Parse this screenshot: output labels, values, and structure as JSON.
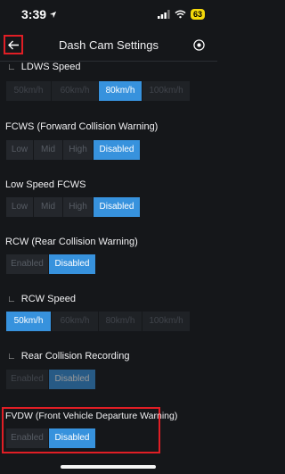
{
  "status": {
    "time": "3:39",
    "battery": "63"
  },
  "header": {
    "title": "Dash Cam Settings"
  },
  "ldws_speed": {
    "label": "LDWS Speed",
    "options": [
      "50km/h",
      "60km/h",
      "80km/h",
      "100km/h"
    ],
    "selected": "80km/h"
  },
  "fcws": {
    "label": "FCWS (Forward Collision Warning)",
    "options": [
      "Low",
      "Mid",
      "High",
      "Disabled"
    ],
    "selected": "Disabled"
  },
  "low_speed_fcws": {
    "label": "Low Speed FCWS",
    "options": [
      "Low",
      "Mid",
      "High",
      "Disabled"
    ],
    "selected": "Disabled"
  },
  "rcw": {
    "label": "RCW (Rear Collision Warning)",
    "options": [
      "Enabled",
      "Disabled"
    ],
    "selected": "Disabled"
  },
  "rcw_speed": {
    "label": "RCW Speed",
    "options": [
      "50km/h",
      "60km/h",
      "80km/h",
      "100km/h"
    ],
    "selected": "50km/h"
  },
  "rear_collision_recording": {
    "label": "Rear Collision Recording",
    "options": [
      "Enabled",
      "Disabled"
    ],
    "selected": "Disabled"
  },
  "fvdw": {
    "label": "FVDW (Front Vehicle Departure Warning)",
    "options": [
      "Enabled",
      "Disabled"
    ],
    "selected": "Disabled"
  },
  "colors": {
    "accent": "#3792dd",
    "highlight": "#e01e25",
    "background": "#15171a"
  }
}
